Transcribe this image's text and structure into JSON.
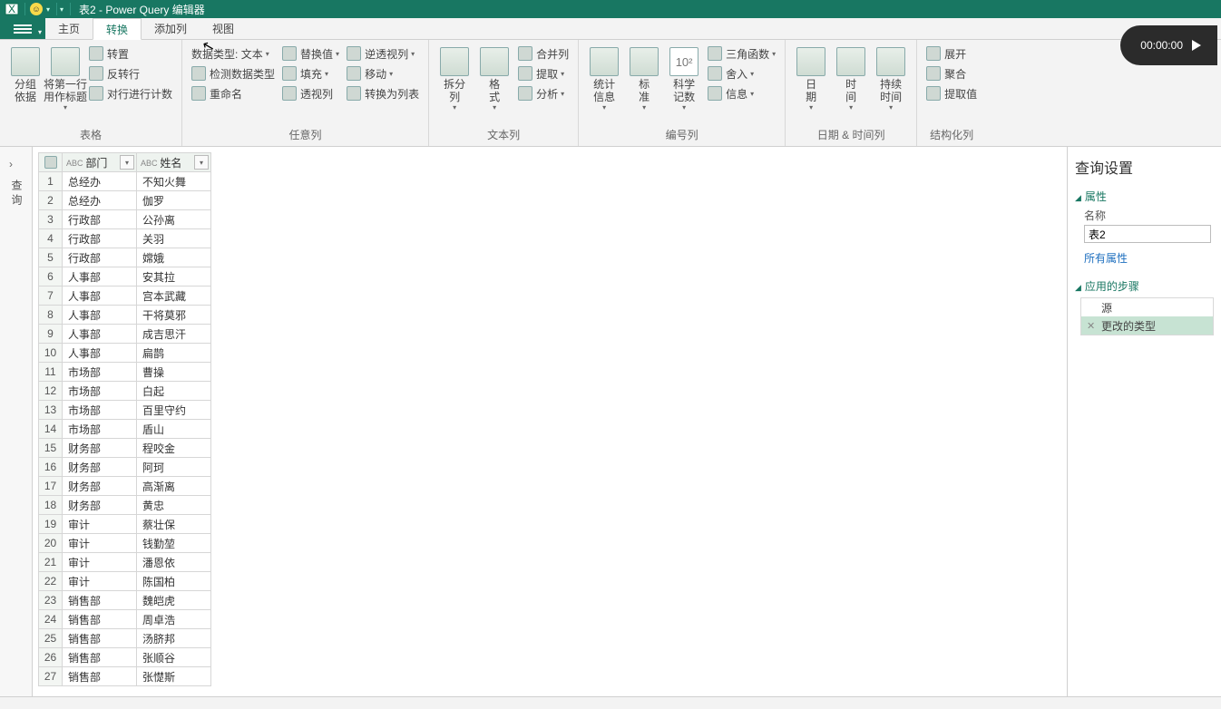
{
  "window": {
    "title": "表2 - Power Query 编辑器"
  },
  "tabs": {
    "file": "文件",
    "home": "主页",
    "transform": "转换",
    "addcol": "添加列",
    "view": "视图",
    "active": "transform"
  },
  "ribbon": {
    "group_table": {
      "label": "表格",
      "groupby": "分组\n依据",
      "firstrow": "将第一行\n用作标题",
      "transpose": "转置",
      "reverse": "反转行",
      "countrows": "对行进行计数"
    },
    "group_anycol": {
      "label": "任意列",
      "datatype_prefix": "数据类型:",
      "datatype_value": "文本",
      "detect": "检测数据类型",
      "rename": "重命名",
      "replace": "替换值",
      "fill": "填充",
      "pivot": "透视列",
      "unpivot": "逆透视列",
      "move": "移动",
      "tolist": "转换为列表"
    },
    "group_textcol": {
      "label": "文本列",
      "split": "拆分\n列",
      "format": "格\n式",
      "merge": "合并列",
      "extract": "提取",
      "parse": "分析"
    },
    "group_numcol": {
      "label": "编号列",
      "stats": "统计\n信息",
      "standard": "标\n准",
      "sci": "科学\n记数",
      "trig": "三角函数",
      "round": "舍入",
      "info": "信息"
    },
    "group_datetime": {
      "label": "日期 & 时间列",
      "date": "日\n期",
      "time": "时\n间",
      "duration": "持续\n时间"
    },
    "group_struct": {
      "label": "结构化列",
      "expand": "展开",
      "aggregate": "聚合",
      "extractval": "提取值"
    }
  },
  "leftgutter": {
    "label": "查询"
  },
  "grid": {
    "columns": [
      {
        "name": "部门",
        "type": "ABC"
      },
      {
        "name": "姓名",
        "type": "ABC"
      }
    ],
    "rows": [
      [
        "总经办",
        "不知火舞"
      ],
      [
        "总经办",
        "伽罗"
      ],
      [
        "行政部",
        "公孙离"
      ],
      [
        "行政部",
        "关羽"
      ],
      [
        "行政部",
        "嫦娥"
      ],
      [
        "人事部",
        "安其拉"
      ],
      [
        "人事部",
        "宫本武藏"
      ],
      [
        "人事部",
        "干将莫邪"
      ],
      [
        "人事部",
        "成吉思汗"
      ],
      [
        "人事部",
        "扁鹊"
      ],
      [
        "市场部",
        "曹操"
      ],
      [
        "市场部",
        "白起"
      ],
      [
        "市场部",
        "百里守约"
      ],
      [
        "市场部",
        "盾山"
      ],
      [
        "财务部",
        "程咬金"
      ],
      [
        "财务部",
        "阿珂"
      ],
      [
        "财务部",
        "高渐离"
      ],
      [
        "财务部",
        "黄忠"
      ],
      [
        "审计",
        "蔡壮保"
      ],
      [
        "审计",
        "钱勤堃"
      ],
      [
        "审计",
        "潘恩依"
      ],
      [
        "审计",
        "陈国柏"
      ],
      [
        "销售部",
        "魏皑虎"
      ],
      [
        "销售部",
        "周卓浩"
      ],
      [
        "销售部",
        "汤脐邦"
      ],
      [
        "销售部",
        "张顺谷"
      ],
      [
        "销售部",
        "张憷斯"
      ]
    ]
  },
  "querysettings": {
    "title": "查询设置",
    "props_header": "属性",
    "name_label": "名称",
    "name_value": "表2",
    "allprops": "所有属性",
    "steps_header": "应用的步骤",
    "steps": [
      {
        "label": "源",
        "removable": false
      },
      {
        "label": "更改的类型",
        "removable": true,
        "selected": true
      }
    ]
  },
  "timer": {
    "value": "00:00:00"
  }
}
